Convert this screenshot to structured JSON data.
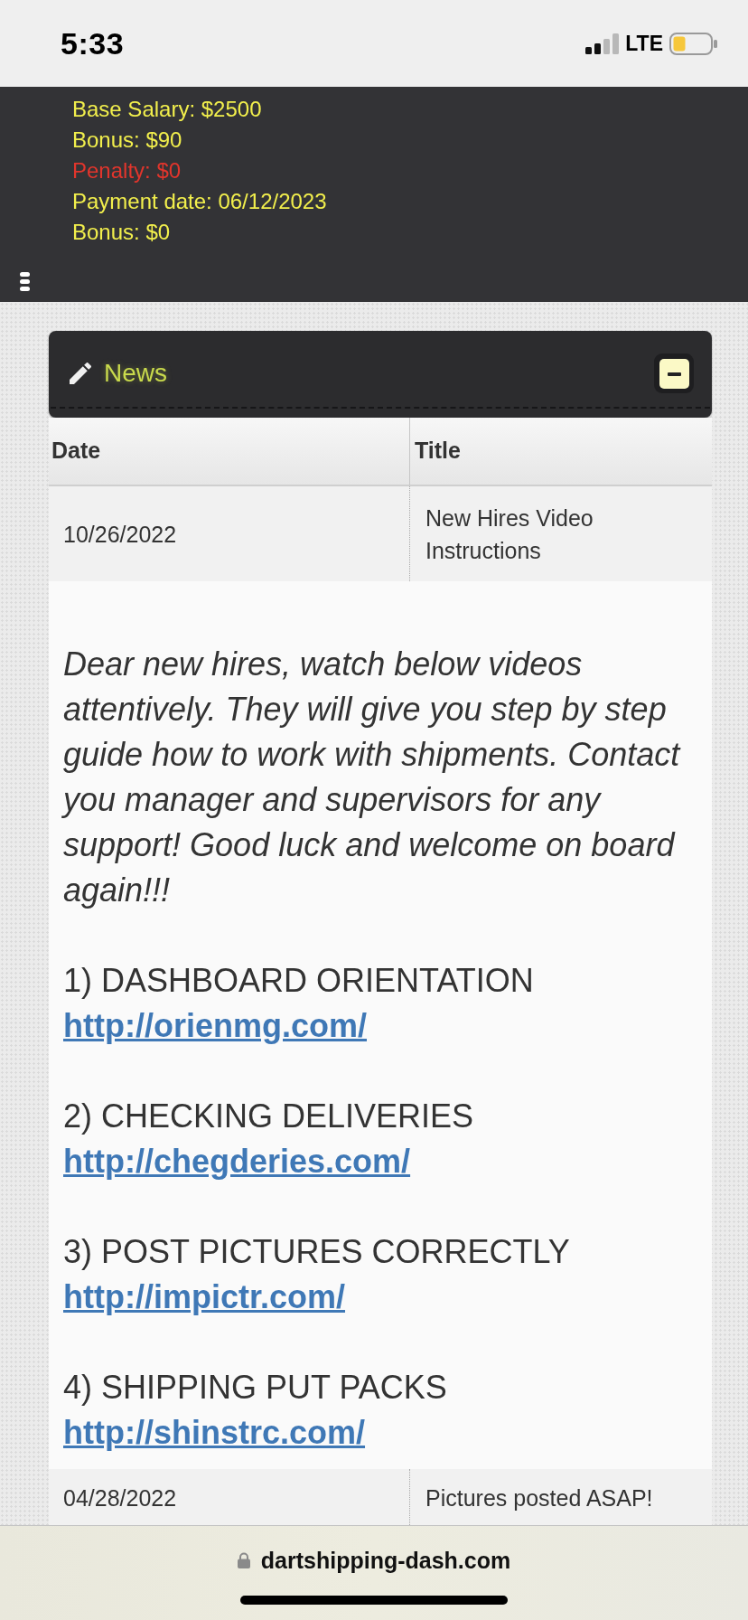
{
  "status_bar": {
    "time": "5:33",
    "network": "LTE"
  },
  "earnings": [
    {
      "text": "Base Salary: $2500",
      "color": "#f2ef4c"
    },
    {
      "text": "Bonus: $90",
      "color": "#f2ef4c"
    },
    {
      "text": "Penalty: $0",
      "color": "#e2352c"
    },
    {
      "text": "Payment date: 06/12/2023",
      "color": "#f2ef4c"
    },
    {
      "text": "Bonus: $0",
      "color": "#f2ef4c"
    }
  ],
  "news": {
    "title": "News",
    "expanded": true,
    "columns": [
      "Date",
      "Title"
    ],
    "rows": [
      {
        "date": "10/26/2022",
        "title": "New Hires Video Instructions",
        "body": {
          "intro": "Dear new hires, watch below videos attentively. They will give you step by step guide how to work with shipments. Contact you manager and supervisors for any support! Good luck and welcome on board again!!!",
          "steps": [
            {
              "heading": "1) DASHBOARD ORIENTATION",
              "link": "http://orienmg.com/"
            },
            {
              "heading": "2) CHECKING DELIVERIES",
              "link": "http://chegderies.com/"
            },
            {
              "heading": "3) POST PICTURES CORRECTLY",
              "link": "http://impictr.com/"
            },
            {
              "heading": "4) SHIPPING PUT PACKS",
              "link": "http://shinstrc.com/"
            }
          ]
        }
      },
      {
        "date": "04/28/2022",
        "title": "Pictures posted ASAP!"
      }
    ]
  },
  "address_bar": {
    "url": "dartshipping-dash.com"
  }
}
